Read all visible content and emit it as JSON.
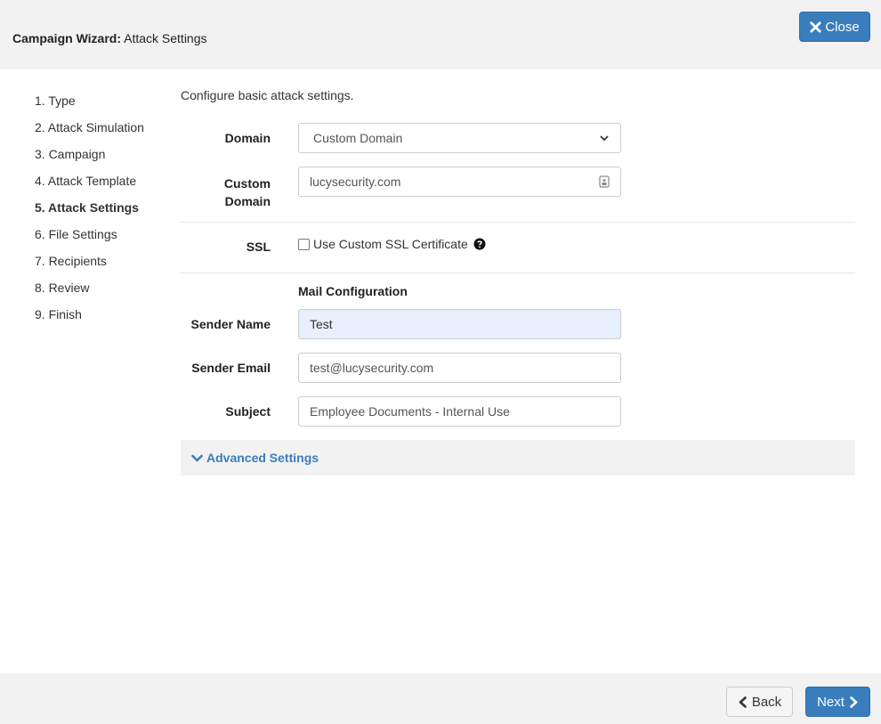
{
  "header": {
    "title_bold": "Campaign Wizard:",
    "title_rest": " Attack Settings",
    "close_label": "Close",
    "close_icon": "times-icon"
  },
  "steps": [
    {
      "label": "1. Type",
      "active": false
    },
    {
      "label": "2. Attack Simulation",
      "active": false
    },
    {
      "label": "3. Campaign",
      "active": false
    },
    {
      "label": "4. Attack Template",
      "active": false
    },
    {
      "label": "5. Attack Settings",
      "active": true
    },
    {
      "label": "6. File Settings",
      "active": false
    },
    {
      "label": "7. Recipients",
      "active": false
    },
    {
      "label": "8. Review",
      "active": false
    },
    {
      "label": "9. Finish",
      "active": false
    }
  ],
  "form": {
    "intro": "Configure basic attack settings.",
    "domain": {
      "label": "Domain",
      "value": "Custom Domain"
    },
    "custom_domain": {
      "label_line1": "Custom",
      "label_line2": "Domain",
      "value": "lucysecurity.com"
    },
    "ssl": {
      "label": "SSL",
      "checkbox_label": "Use Custom SSL Certificate",
      "checked": false
    },
    "mail_section_title": "Mail Configuration",
    "sender_name": {
      "label": "Sender Name",
      "value": "Test"
    },
    "sender_email": {
      "label": "Sender Email",
      "value": "test@lucysecurity.com"
    },
    "subject": {
      "label": "Subject",
      "value": "Employee Documents - Internal Use"
    },
    "advanced_label": "Advanced Settings"
  },
  "footer": {
    "back_label": "Back",
    "next_label": "Next"
  },
  "colors": {
    "primary": "#3a7dbd",
    "header_bg": "#f2f2f2",
    "autofill_bg": "#e8f0fe"
  }
}
